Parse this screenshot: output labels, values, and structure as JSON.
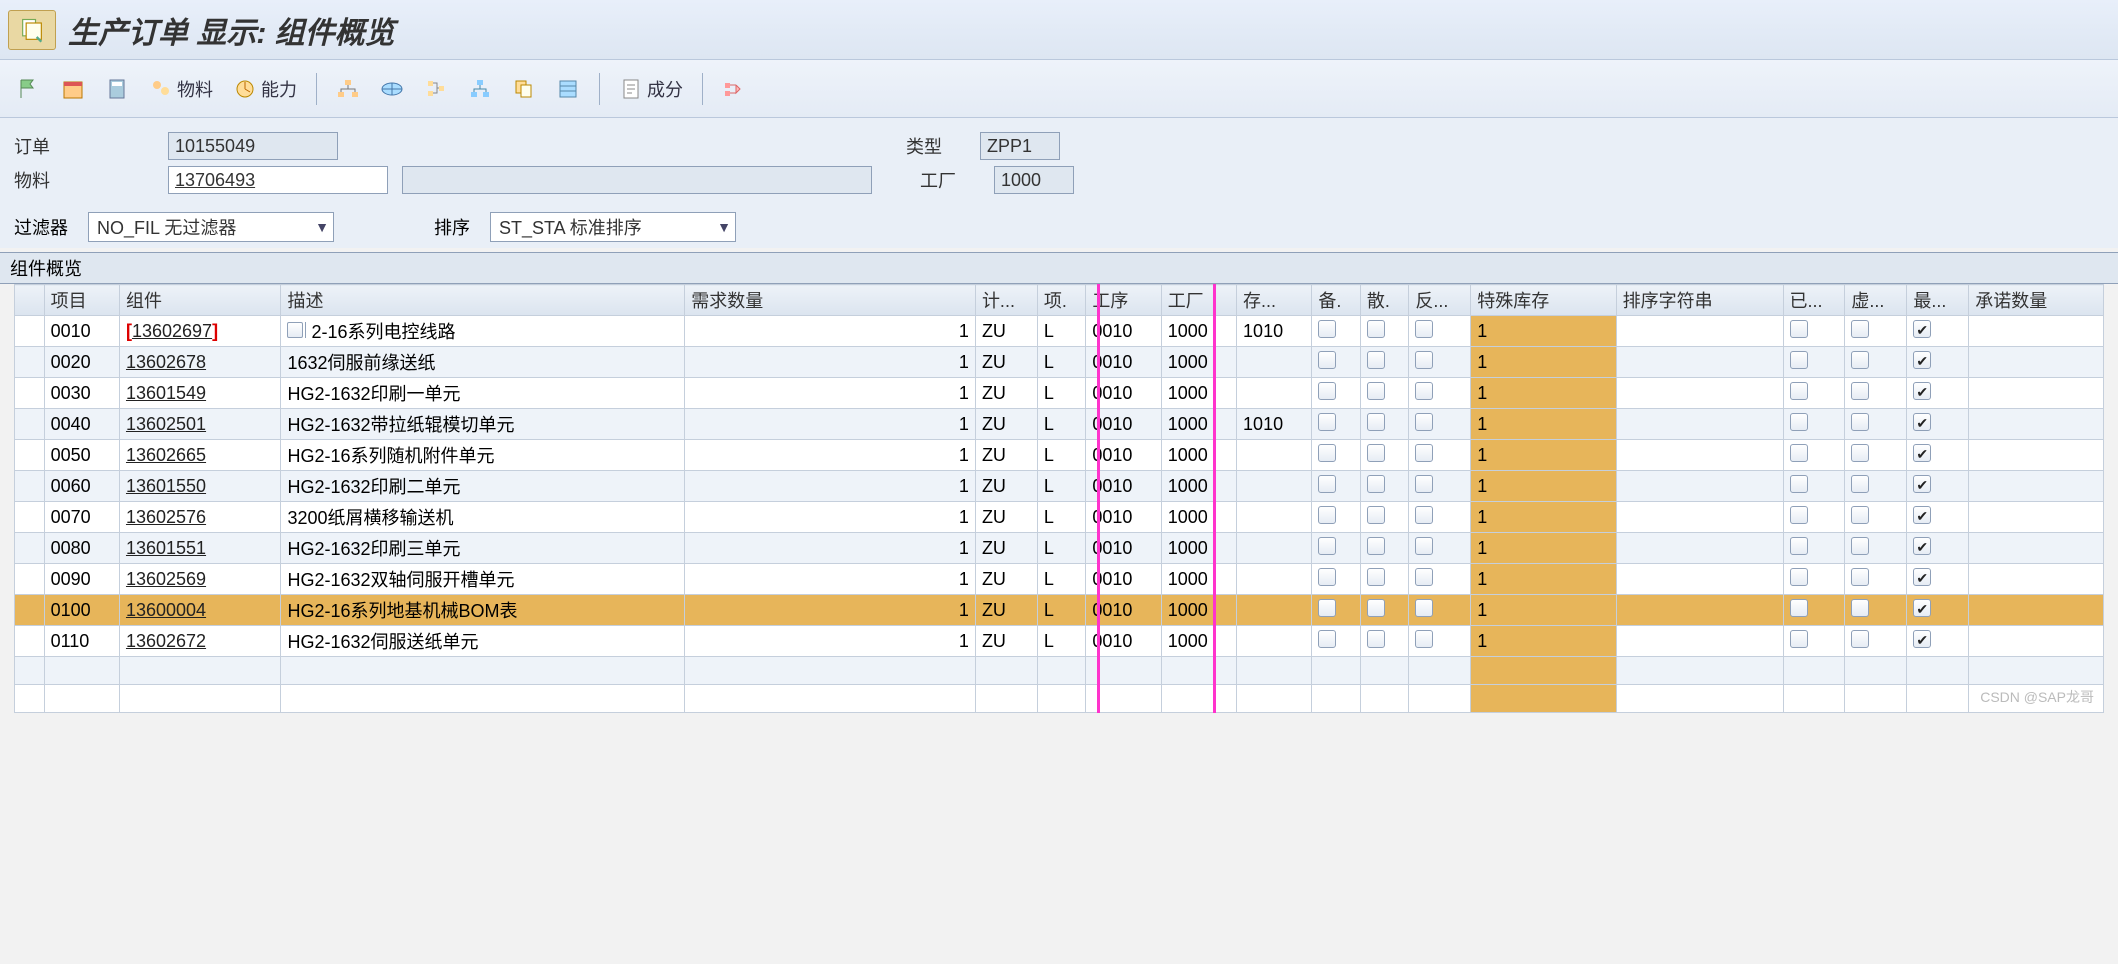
{
  "header": {
    "title": "生产订单 显示: 组件概览"
  },
  "toolbar": {
    "material_label": "物料",
    "capacity_label": "能力",
    "components_label": "成分"
  },
  "form": {
    "order_label": "订单",
    "order_value": "10155049",
    "material_label": "物料",
    "material_value": "13706493",
    "type_label": "类型",
    "type_value": "ZPP1",
    "plant_label": "工厂",
    "plant_value": "1000"
  },
  "filter": {
    "filter_label": "过滤器",
    "filter_value": "NO_FIL 无过滤器",
    "sort_label": "排序",
    "sort_value": "ST_STA 标准排序"
  },
  "section_title": "组件概览",
  "columns": {
    "item": "项目",
    "component": "组件",
    "desc": "描述",
    "req_qty": "需求数量",
    "uom": "计...",
    "itm_cat": "项.",
    "oper": "工序",
    "plant": "工厂",
    "stor": "存...",
    "batch": "备.",
    "bulk": "散.",
    "back": "反...",
    "sp_stock": "特殊库存",
    "sort_str": "${排序字符串}",
    "iss": "已...",
    "phan": "虚...",
    "max": "最...",
    "commit": "承诺数量"
  },
  "sort_str_label": "排序字符串",
  "rows": [
    {
      "item": "0010",
      "comp": "13602697",
      "desc": "2-16系列电控线路",
      "qty": "1",
      "uom": "ZU",
      "ic": "L",
      "op": "0010",
      "pl": "1000",
      "st": "1010",
      "sk": "1",
      "chk": true,
      "sel": true,
      "search": true
    },
    {
      "item": "0020",
      "comp": "13602678",
      "desc": "1632伺服前缘送纸",
      "qty": "1",
      "uom": "ZU",
      "ic": "L",
      "op": "0010",
      "pl": "1000",
      "st": "",
      "sk": "1",
      "chk": true
    },
    {
      "item": "0030",
      "comp": "13601549",
      "desc": "HG2-1632印刷一单元",
      "qty": "1",
      "uom": "ZU",
      "ic": "L",
      "op": "0010",
      "pl": "1000",
      "st": "",
      "sk": "1",
      "chk": true
    },
    {
      "item": "0040",
      "comp": "13602501",
      "desc": "HG2-1632带拉纸辊模切单元",
      "qty": "1",
      "uom": "ZU",
      "ic": "L",
      "op": "0010",
      "pl": "1000",
      "st": "1010",
      "sk": "1",
      "chk": true
    },
    {
      "item": "0050",
      "comp": "13602665",
      "desc": "HG2-16系列随机附件单元",
      "qty": "1",
      "uom": "ZU",
      "ic": "L",
      "op": "0010",
      "pl": "1000",
      "st": "",
      "sk": "1",
      "chk": true
    },
    {
      "item": "0060",
      "comp": "13601550",
      "desc": "HG2-1632印刷二单元",
      "qty": "1",
      "uom": "ZU",
      "ic": "L",
      "op": "0010",
      "pl": "1000",
      "st": "",
      "sk": "1",
      "chk": true
    },
    {
      "item": "0070",
      "comp": "13602576",
      "desc": "3200纸屑横移输送机",
      "qty": "1",
      "uom": "ZU",
      "ic": "L",
      "op": "0010",
      "pl": "1000",
      "st": "",
      "sk": "1",
      "chk": true
    },
    {
      "item": "0080",
      "comp": "13601551",
      "desc": "HG2-1632印刷三单元",
      "qty": "1",
      "uom": "ZU",
      "ic": "L",
      "op": "0010",
      "pl": "1000",
      "st": "",
      "sk": "1",
      "chk": true
    },
    {
      "item": "0090",
      "comp": "13602569",
      "desc": "HG2-1632双轴伺服开槽单元",
      "qty": "1",
      "uom": "ZU",
      "ic": "L",
      "op": "0010",
      "pl": "1000",
      "st": "",
      "sk": "1",
      "chk": true
    },
    {
      "item": "0100",
      "comp": "13600004",
      "desc": "HG2-16系列地基机械BOM表",
      "qty": "1",
      "uom": "ZU",
      "ic": "L",
      "op": "0010",
      "pl": "1000",
      "st": "",
      "sk": "1",
      "chk": true,
      "hl": true
    },
    {
      "item": "0110",
      "comp": "13602672",
      "desc": "HG2-1632伺服送纸单元",
      "qty": "1",
      "uom": "ZU",
      "ic": "L",
      "op": "0010",
      "pl": "1000",
      "st": "",
      "sk": "1",
      "chk": true
    }
  ],
  "watermark": "CSDN @SAP龙哥"
}
